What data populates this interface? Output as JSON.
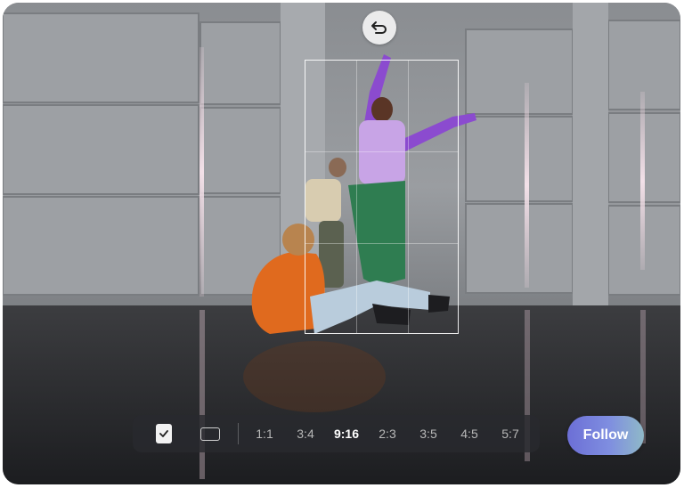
{
  "toolbar": {
    "ratios": [
      {
        "label": "1:1",
        "active": false
      },
      {
        "label": "3:4",
        "active": false
      },
      {
        "label": "9:16",
        "active": true
      },
      {
        "label": "2:3",
        "active": false
      },
      {
        "label": "3:5",
        "active": false
      },
      {
        "label": "4:5",
        "active": false
      },
      {
        "label": "5:7",
        "active": false
      }
    ]
  },
  "follow_button": {
    "label": "Follow"
  },
  "colors": {
    "follow_gradient_start": "#6c6fd6",
    "follow_gradient_end": "#8fb9c8",
    "toolbar_bg": "#282a2e"
  },
  "icons": {
    "undo": "undo-arrow-icon",
    "check": "checkbox-checked-icon",
    "rect": "frame-rectangle-icon"
  }
}
